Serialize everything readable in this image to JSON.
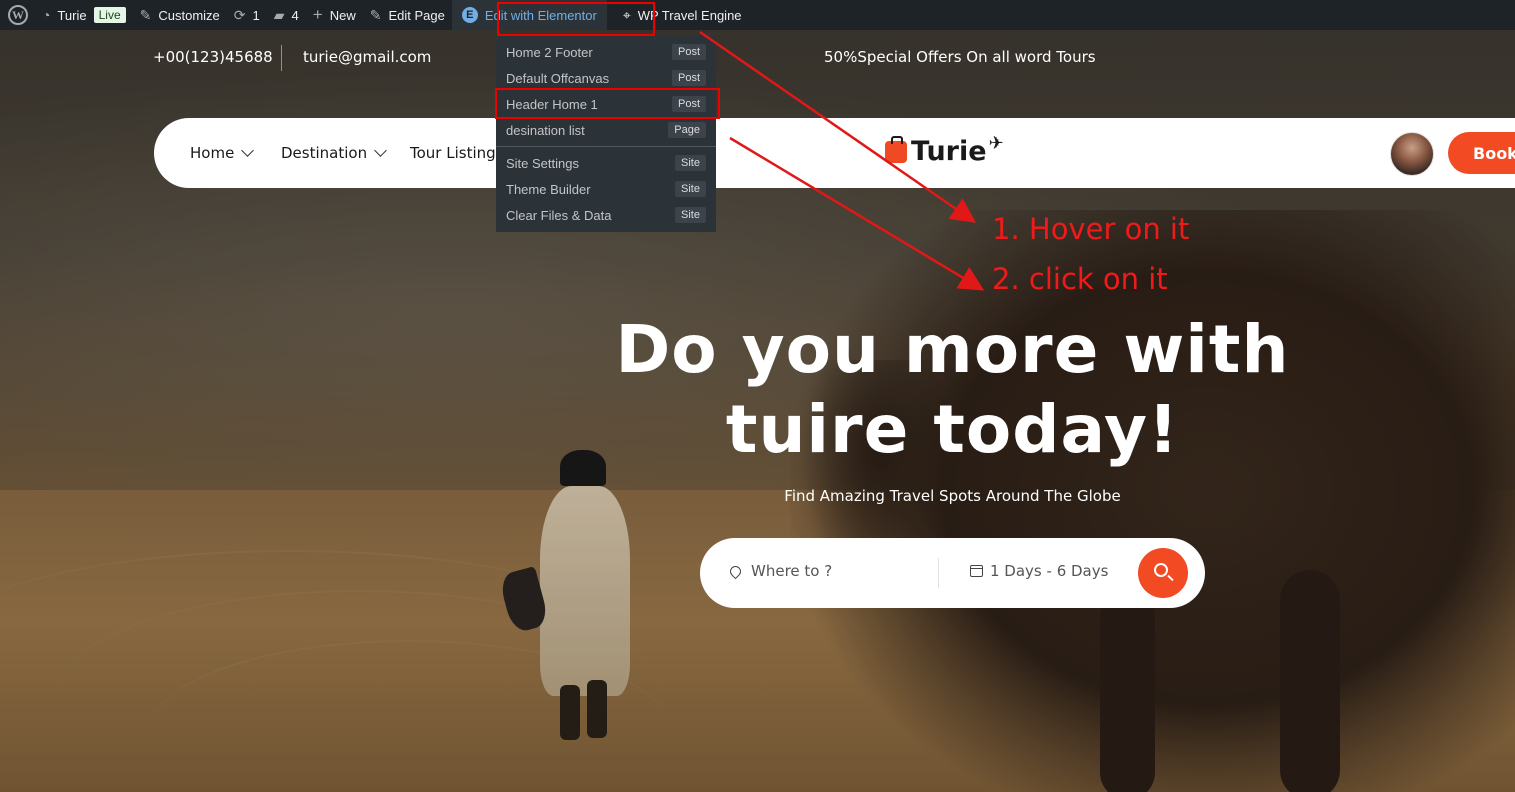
{
  "admin_bar": {
    "site_name": "Turie",
    "live_badge": "Live",
    "customize": "Customize",
    "updates_count": "1",
    "comments_count": "4",
    "new_label": "New",
    "edit_page": "Edit Page",
    "edit_with_elementor": "Edit with Elementor",
    "wp_travel_engine": "WP Travel Engine"
  },
  "elementor_menu": {
    "items": [
      {
        "label": "Home 2 Footer",
        "tag": "Post"
      },
      {
        "label": "Default Offcanvas",
        "tag": "Post"
      },
      {
        "label": "Header Home 1",
        "tag": "Post"
      },
      {
        "label": "desination list",
        "tag": "Page"
      },
      {
        "label": "Site Settings",
        "tag": "Site"
      },
      {
        "label": "Theme Builder",
        "tag": "Site"
      },
      {
        "label": "Clear Files & Data",
        "tag": "Site"
      }
    ]
  },
  "topbar": {
    "phone": "+00(123)45688",
    "email": "turie@gmail.com",
    "offer": "50%Special Offers On all word Tours"
  },
  "nav": {
    "items": [
      "Home",
      "Destination",
      "Tour Listing"
    ],
    "logo_text": "Turie",
    "book_label": "Book"
  },
  "hero": {
    "headline_line1": "Do you more with",
    "headline_line2": "tuire today!",
    "subheadline": "Find Amazing Travel Spots Around The Globe"
  },
  "search": {
    "where_placeholder": "Where to ?",
    "duration": "1 Days - 6 Days"
  },
  "annotations": {
    "step1": "1. Hover on it",
    "step2": "2. click on it"
  },
  "colors": {
    "accent": "#f24b24",
    "admin_bar": "#1d2327",
    "annotation_red": "#f01a1a"
  }
}
